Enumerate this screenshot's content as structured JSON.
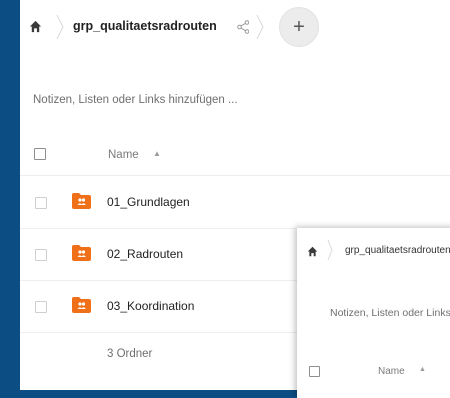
{
  "breadcrumb": {
    "folder": "grp_qualitaetsradrouten",
    "add_label": "+"
  },
  "notes_placeholder": "Notizen, Listen oder Links hinzufügen ...",
  "table": {
    "column_name": "Name",
    "sort_indicator": "▲"
  },
  "files": [
    {
      "name": "01_Grundlagen"
    },
    {
      "name": "02_Radrouten"
    },
    {
      "name": "03_Koordination"
    }
  ],
  "summary": "3 Ordner",
  "overlay": {
    "crumb": "grp_qualitaetsradrouten",
    "notes": "Notizen, Listen oder Links hinzufügen ...",
    "column_name": "Name",
    "sort_indicator": "▲"
  },
  "colors": {
    "background": "#0c4d83",
    "folder": "#f07019"
  },
  "icons": {
    "home": "home-icon",
    "share": "share-icon",
    "folder": "shared-folder-icon"
  }
}
